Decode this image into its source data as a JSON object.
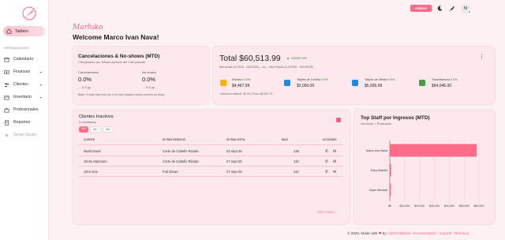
{
  "sidebar": {
    "active": "Tablero",
    "section_title": "HERRAMIENTAS",
    "items": [
      {
        "label": "Calendario",
        "icon": "calendar-icon"
      },
      {
        "label": "Finanzas",
        "icon": "money-icon"
      },
      {
        "label": "Clientes",
        "icon": "users-icon"
      },
      {
        "label": "Inventario",
        "icon": "box-icon"
      },
      {
        "label": "Profesionales",
        "icon": "briefcase-icon"
      },
      {
        "label": "Reportes",
        "icon": "report-icon"
      },
      {
        "label": "Smart Goals",
        "icon": "sparkle-icon"
      }
    ]
  },
  "topbar": {
    "cobrar": "COBRAR",
    "avatar": "M"
  },
  "header": {
    "brand": "Marluko",
    "welcome": "Welcome Marco Ivan Nava!"
  },
  "cancel_card": {
    "title": "Cancelaciones & No-shows (MTD)",
    "subtitle": "Comparado con mismo periodo del mes pasado",
    "cancel_label": "Cancelaciones",
    "cancel_value": "0.0%",
    "cancel_delta": "0.0 pp",
    "noshow_label": "No-shows",
    "noshow_value": "0.0%",
    "noshow_delta": "0.0 pp",
    "base_note": "Base: 0 citas este mes (vs 0 en mes pasado mismo número de días)."
  },
  "total_card": {
    "total": "Total $60,513.99",
    "growth": "+30157.0%",
    "period": "Mes Actual (1/1/2025 - 15/1/2026) — vs — Mes Pasado (1/12/2025 - 15/12/2025)",
    "methods": [
      {
        "label": "Efectivo",
        "tag": "0.0%",
        "value": "$4,467.99",
        "color": "#ffb300"
      },
      {
        "label": "Tarjeta de Crédito",
        "tag": "0.0%",
        "value": "$2,000.00",
        "color": "#1e88e5"
      },
      {
        "label": "Tarjeta de Débito",
        "tag": "0.0%",
        "value": "$5,935.99",
        "color": "#1e88e5"
      },
      {
        "label": "Transferencia",
        "tag": "0.0%",
        "value": "$54,046.00",
        "color": "#43a047"
      }
    ],
    "unknown": "Unknown method: $0.00 | Pcan: $5,281.70"
  },
  "inactive_card": {
    "title": "Clientes Inactivos",
    "count": "3 resultados",
    "filters": [
      "30+",
      "60+",
      "90+"
    ],
    "columns": [
      "CLIENTE",
      "ÚLTIMO SERVICIO",
      "ÚLTIMA VISITA",
      "DÍAS",
      "ACCIONES"
    ],
    "rows": [
      {
        "cliente": "Noah Davis",
        "servicio": "Corte de Cabello Rizado",
        "visita": "02 sept 25",
        "dias": "135"
      },
      {
        "cliente": "Jonhy Manzano",
        "servicio": "Corte de Cabello Rizado",
        "visita": "27 sept 25",
        "dias": "110"
      },
      {
        "cliente": "John Doe",
        "servicio": "Full Glown",
        "visita": "27 sept 25",
        "dias": "110"
      }
    ],
    "view_all": "VER TODO"
  },
  "staff_card": {
    "title": "Top Staff por Ingresos (MTD)",
    "subtitle": "Servicios + Productos"
  },
  "chart_data": {
    "type": "bar",
    "orientation": "horizontal",
    "categories": [
      "Marco Ivan Nava",
      "Erika Zisimile",
      "Super Mendak"
    ],
    "values": [
      58500,
      900,
      700
    ],
    "xlim": [
      0,
      60000
    ],
    "xticks": [
      "$0",
      "$10,000",
      "$20,000",
      "$30,000",
      "$40,000",
      "$50,000",
      "$60,000"
    ],
    "xtick_values": [
      0,
      10000,
      20000,
      30000,
      40000,
      50000,
      60000
    ],
    "bar_color": "#ff6b89"
  },
  "footer": {
    "made": "© 2026, Made with",
    "by": "by",
    "author": "AliveProMedia",
    "links": [
      "Documentation",
      "Soporte",
      "Términos"
    ]
  }
}
